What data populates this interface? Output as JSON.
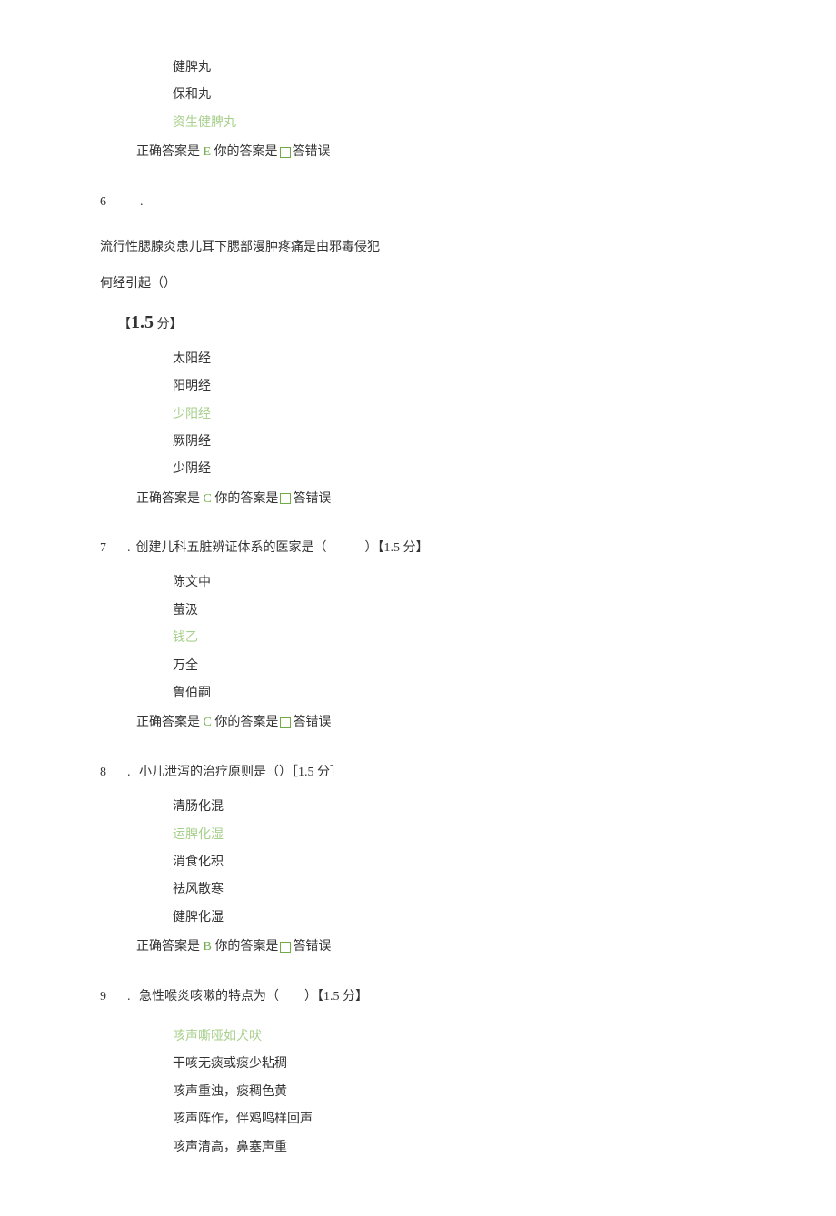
{
  "q5_tail": {
    "options": [
      {
        "text": "健脾丸",
        "highlighted": false
      },
      {
        "text": "保和丸",
        "highlighted": false
      },
      {
        "text": "资生健脾丸",
        "highlighted": true
      }
    ],
    "feedback": {
      "prefix": "正确答案是 ",
      "letter": "E",
      "mid": " 你的答案是",
      "tail": "答错误"
    }
  },
  "q6": {
    "number": "6",
    "dot": ".",
    "stem_l1": "流行性腮腺炎患儿耳下腮部漫肿疼痛是由邪毒侵犯",
    "stem_l2": "何经引起（）",
    "points_prefix": "【",
    "points_value": "1.5",
    "points_unit": " 分",
    "points_suffix": "】",
    "options": [
      {
        "text": "太阳经",
        "highlighted": false
      },
      {
        "text": "阳明经",
        "highlighted": false
      },
      {
        "text": "少阳经",
        "highlighted": true
      },
      {
        "text": "厥阴经",
        "highlighted": false
      },
      {
        "text": "少阴经",
        "highlighted": false
      }
    ],
    "feedback": {
      "prefix": "正确答案是 ",
      "letter": "C",
      "mid": " 你的答案是",
      "tail": "答错误"
    }
  },
  "q7": {
    "number": "7",
    "dot": ".",
    "stem": "创建儿科五脏辨证体系的医家是（　　　）【1.5 分】",
    "options": [
      {
        "text": "陈文中",
        "highlighted": false
      },
      {
        "text": "萤汲",
        "highlighted": false
      },
      {
        "text": "钱乙",
        "highlighted": true
      },
      {
        "text": "万全",
        "highlighted": false
      },
      {
        "text": "鲁伯嗣",
        "highlighted": false
      }
    ],
    "feedback": {
      "prefix": "正确答案是 ",
      "letter": "C",
      "mid": " 你的答案是",
      "tail": "答错误"
    }
  },
  "q8": {
    "number": "8",
    "dot": ".",
    "stem": " 小儿泄泻的治疗原则是（）［1.5 分］",
    "options": [
      {
        "text": "清肠化混",
        "highlighted": false
      },
      {
        "text": "运脾化湿",
        "highlighted": true
      },
      {
        "text": "消食化积",
        "highlighted": false
      },
      {
        "text": "祛风散寒",
        "highlighted": false
      },
      {
        "text": "健脾化湿",
        "highlighted": false
      }
    ],
    "feedback": {
      "prefix": "正确答案是 ",
      "letter": "B",
      "mid": " 你的答案是",
      "tail": "答错误"
    }
  },
  "q9": {
    "number": "9",
    "dot": ".",
    "stem": " 急性喉炎咳嗽的特点为（　　）【1.5 分】",
    "options": [
      {
        "text": "咳声嘶哑如犬吠",
        "highlighted": true
      },
      {
        "text": "干咳无痰或痰少粘稠",
        "highlighted": false
      },
      {
        "text": "咳声重浊，痰稠色黄",
        "highlighted": false
      },
      {
        "text": "咳声阵作，伴鸡鸣样回声",
        "highlighted": false
      },
      {
        "text": "咳声清高，鼻塞声重",
        "highlighted": false
      }
    ]
  }
}
